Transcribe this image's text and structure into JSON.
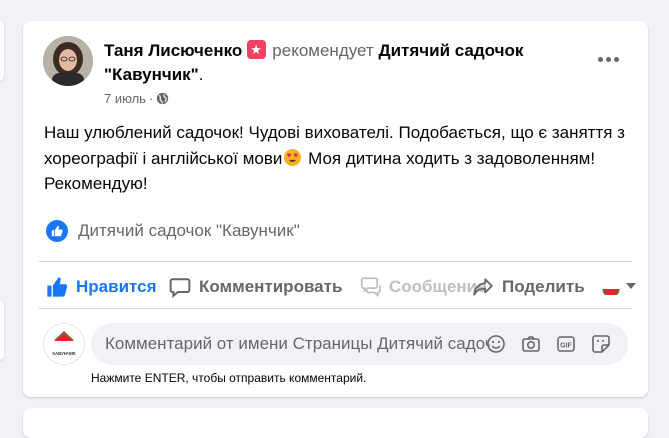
{
  "post": {
    "author": "Таня Лисюченко",
    "verb": "рекомендует",
    "page": "Дитячий садочок \"Кавунчик\"",
    "page_suffix": ".",
    "date": "7 июль",
    "date_sep": "·",
    "text_part1": "Наш улюблений садочок! Чудові вихователі. Подобається, що є заняття з хореографії і англійської мови",
    "text_part2": " Моя дитина ходить з задоволенням! Рекомендую!",
    "recommendation_page": "Дитячий садочок \"Кавунчик\""
  },
  "actions": {
    "like": "Нравится",
    "comment": "Комментировать",
    "message": "Сообщение",
    "share": "Поделиться"
  },
  "comment": {
    "placeholder": "Комментарий от имени Страницы Дитячий садочок \"Кавунчик\"",
    "hint": "Нажмите ENTER, чтобы отправить комментарий."
  },
  "commenter_avatar_text": "КАВУНЧИК",
  "colors": {
    "accent": "#1877f2",
    "muted": "#65676b",
    "background": "#f0f2f5",
    "badge": "#f3425f",
    "watermelon": "#e3262e"
  },
  "icons": [
    "star-badge-icon",
    "globe-icon",
    "more-icon",
    "thumbs-up-icon",
    "comment-icon",
    "message-icon",
    "share-icon",
    "chevron-down-icon",
    "emoji-icon",
    "camera-icon",
    "gif-icon",
    "sticker-icon",
    "heart-eyes-emoji"
  ]
}
